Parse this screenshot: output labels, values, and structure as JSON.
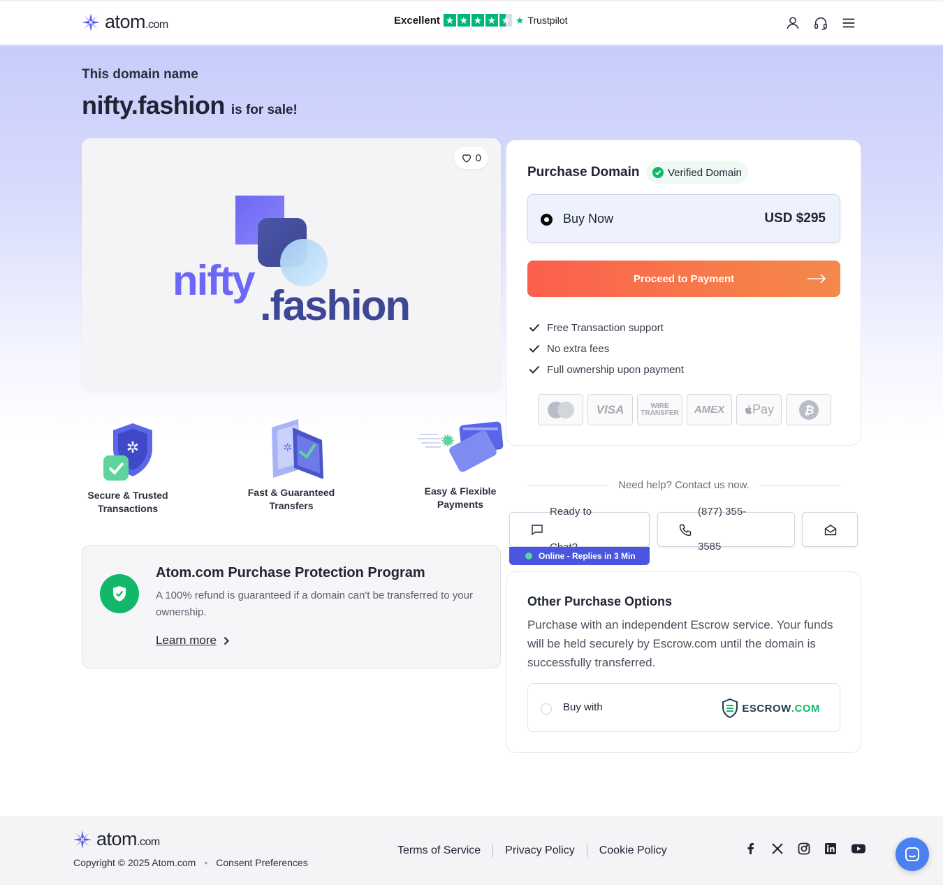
{
  "header": {
    "brand": "atom",
    "brand_suffix": ".com",
    "trust_rating": "Excellent",
    "trust_stars": 4.5,
    "trust_name": "Trustpilot",
    "icons": [
      "user-icon",
      "headset-icon",
      "menu-icon"
    ]
  },
  "hero": {
    "subtitle": "This domain name",
    "domain": "nifty.fashion",
    "for_sale": "is for sale!"
  },
  "image_card": {
    "likes": "0",
    "art_word1": "nifty",
    "art_word2": ".fashion"
  },
  "features": [
    {
      "line1": "Secure & Trusted",
      "line2": "Transactions"
    },
    {
      "line1": "Fast & Guaranteed",
      "line2": "Transfers"
    },
    {
      "line1": "Easy & Flexible",
      "line2": "Payments"
    }
  ],
  "protection": {
    "title": "Atom.com Purchase Protection Program",
    "text": "A 100% refund is guaranteed if a domain can't be transferred to your ownership.",
    "link": "Learn more"
  },
  "purchase": {
    "title": "Purchase Domain",
    "verified": "Verified Domain",
    "option_label": "Buy Now",
    "price": "USD $295",
    "button": "Proceed to Payment",
    "benefits": [
      "Free Transaction support",
      "No extra fees",
      "Full ownership upon payment"
    ],
    "payment_methods": [
      "mastercard-icon",
      "VISA",
      "WIRE TRANSFER",
      "AMEX",
      "Pay",
      "bitcoin-icon"
    ]
  },
  "help": {
    "text": "Need help? Contact us now.",
    "chat_line1": "Ready to",
    "chat_line2": "Chat?",
    "phone_line1": "(877) 355-",
    "phone_line2": "3585",
    "online": "Online - Replies in 3 Min"
  },
  "other": {
    "title": "Other Purchase Options",
    "text": "Purchase with an independent Escrow service. Your funds will be held securely by Escrow.com until the domain is successfully transferred.",
    "option_label": "Buy with",
    "escrow_brand": "ESCROW",
    "escrow_suffix": ".COM"
  },
  "footer": {
    "brand": "atom",
    "brand_suffix": ".com",
    "copyright": "Copyright © 2025 Atom.com",
    "consent": "Consent Preferences",
    "links": [
      "Terms of Service",
      "Privacy Policy",
      "Cookie Policy"
    ],
    "socials": [
      "facebook-icon",
      "x-icon",
      "instagram-icon",
      "linkedin-icon",
      "youtube-icon"
    ]
  },
  "colors": {
    "accent": "#4a55e0",
    "cta_start": "#fb5f4d",
    "cta_end": "#f4884b",
    "success": "#12b76a",
    "trustpilot": "#00b67a"
  }
}
